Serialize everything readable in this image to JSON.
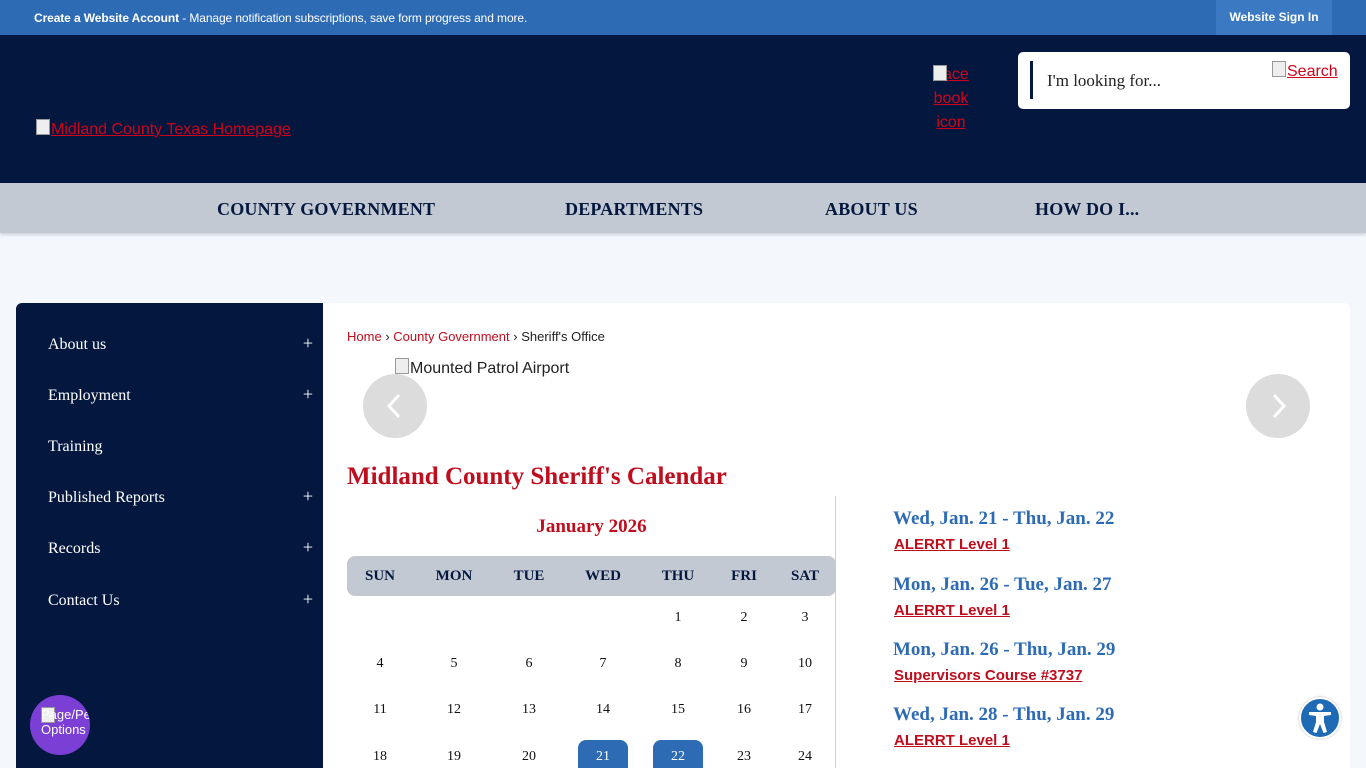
{
  "topbar": {
    "create_account": "Create a Website Account",
    "message": " - Manage notification subscriptions, save form progress and more.",
    "signin": "Website Sign In"
  },
  "header": {
    "logo_alt": "Midland County Texas Homepage",
    "facebook_alt": "Facebook icon",
    "search_placeholder": "I'm looking for...",
    "search_button": "Search"
  },
  "nav": {
    "items": [
      "COUNTY GOVERNMENT",
      "DEPARTMENTS",
      "ABOUT US",
      "HOW DO I..."
    ]
  },
  "sidebar": {
    "items": [
      {
        "label": "About us",
        "expand": "+"
      },
      {
        "label": "Employment",
        "expand": "+"
      },
      {
        "label": "Training",
        "expand": ""
      },
      {
        "label": "Published Reports",
        "expand": "+"
      },
      {
        "label": "Records",
        "expand": "+"
      },
      {
        "label": "Contact Us",
        "expand": "+"
      }
    ]
  },
  "breadcrumb": {
    "home": "Home",
    "county_gov": "County Government",
    "current": "Sheriff's Office",
    "sep": "›"
  },
  "slideshow": {
    "image_alt": "Mounted Patrol Airport"
  },
  "calendar": {
    "title": "Midland County Sheriff's Calendar",
    "month": "January 2026",
    "weekdays": [
      "SUN",
      "MON",
      "TUE",
      "WED",
      "THU",
      "FRI",
      "SAT"
    ],
    "weeks": [
      [
        "",
        "",
        "",
        "",
        "1",
        "2",
        "3"
      ],
      [
        "4",
        "5",
        "6",
        "7",
        "8",
        "9",
        "10"
      ],
      [
        "11",
        "12",
        "13",
        "14",
        "15",
        "16",
        "17"
      ],
      [
        "18",
        "19",
        "20",
        "21",
        "22",
        "23",
        "24"
      ]
    ],
    "highlighted": [
      "21",
      "22"
    ]
  },
  "events": [
    {
      "date": "Wed, Jan. 21 - Thu, Jan. 22",
      "title": "ALERRT Level 1"
    },
    {
      "date": "Mon, Jan. 26 - Tue, Jan. 27",
      "title": "ALERRT Level 1"
    },
    {
      "date": "Mon, Jan. 26 - Thu, Jan. 29",
      "title": "Supervisors Course #3737"
    },
    {
      "date": "Wed, Jan. 28 - Thu, Jan. 29",
      "title": "ALERRT Level 1"
    }
  ],
  "floating": {
    "page_options_alt": "Page/Personalization Options"
  },
  "colors": {
    "navy": "#04183f",
    "blue": "#2e6bb5",
    "red": "#c00d1e",
    "gray": "#c2c9d3"
  }
}
